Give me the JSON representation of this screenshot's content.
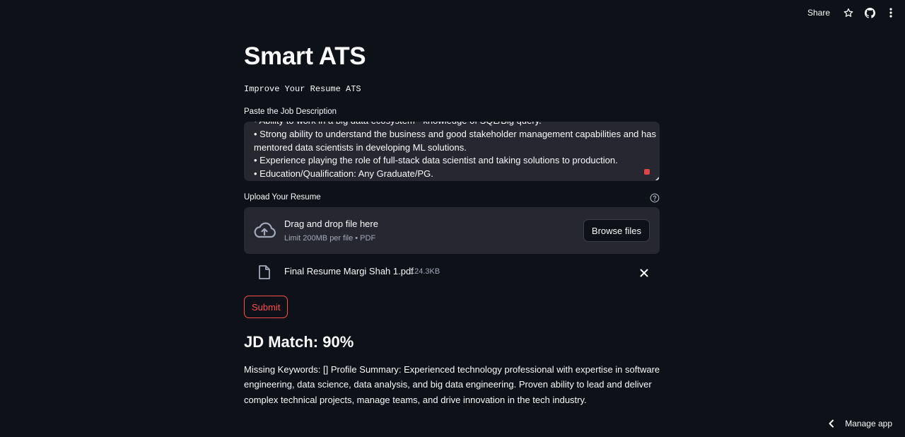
{
  "toolbar": {
    "share_label": "Share",
    "icons": [
      "star-icon",
      "github-icon",
      "more-vertical-icon"
    ]
  },
  "app": {
    "title": "Smart ATS",
    "subtitle": "Improve Your Resume ATS"
  },
  "job_description": {
    "label": "Paste the Job Description",
    "lines": [
      "• Ability to work in a big data ecosystem - knowledge of SQL/Big query.",
      "• Strong ability to understand the business and good stakeholder management capabilities and has",
      "mentored data scientists in developing ML solutions.",
      "• Experience playing the role of full-stack data scientist and taking solutions to production.",
      "• Education/Qualification: Any Graduate/PG."
    ]
  },
  "upload": {
    "label": "Upload Your Resume",
    "dropzone_title": "Drag and drop file here",
    "dropzone_limit": "Limit 200MB per file • PDF",
    "browse_label": "Browse files",
    "file": {
      "name": "Final Resume Margi Shah 1.pdf",
      "size": "124.3KB"
    }
  },
  "submit_label": "Submit",
  "result": {
    "heading": "JD Match: 90%",
    "lines": [
      "Missing Keywords: [] Profile Summary: Experienced technology professional with expertise in software",
      "engineering, data science, data analysis, and big data engineering. Proven ability to lead and deliver",
      "complex technical projects, manage teams, and drive innovation in the tech industry."
    ]
  },
  "footer": {
    "manage_app_label": "Manage app"
  },
  "colors": {
    "background": "#0e1117",
    "surface": "#262730",
    "accent": "#ff4b4b",
    "text": "#fafafa",
    "muted": "#a3a8b8"
  }
}
